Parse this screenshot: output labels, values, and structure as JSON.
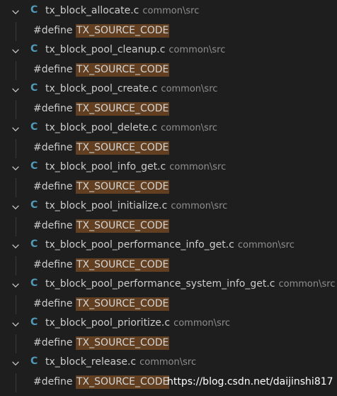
{
  "results": [
    {
      "file": "tx_block_allocate.c",
      "path": "common\\src",
      "match_prefix": "#define ",
      "match_highlight": "TX_SOURCE_CODE"
    },
    {
      "file": "tx_block_pool_cleanup.c",
      "path": "common\\src",
      "match_prefix": "#define ",
      "match_highlight": "TX_SOURCE_CODE"
    },
    {
      "file": "tx_block_pool_create.c",
      "path": "common\\src",
      "match_prefix": "#define ",
      "match_highlight": "TX_SOURCE_CODE"
    },
    {
      "file": "tx_block_pool_delete.c",
      "path": "common\\src",
      "match_prefix": "#define ",
      "match_highlight": "TX_SOURCE_CODE"
    },
    {
      "file": "tx_block_pool_info_get.c",
      "path": "common\\src",
      "match_prefix": "#define ",
      "match_highlight": "TX_SOURCE_CODE"
    },
    {
      "file": "tx_block_pool_initialize.c",
      "path": "common\\src",
      "match_prefix": "#define ",
      "match_highlight": "TX_SOURCE_CODE"
    },
    {
      "file": "tx_block_pool_performance_info_get.c",
      "path": "common\\src",
      "match_prefix": "#define ",
      "match_highlight": "TX_SOURCE_CODE"
    },
    {
      "file": "tx_block_pool_performance_system_info_get.c",
      "path": "common\\src",
      "match_prefix": "#define ",
      "match_highlight": "TX_SOURCE_CODE"
    },
    {
      "file": "tx_block_pool_prioritize.c",
      "path": "common\\src",
      "match_prefix": "#define ",
      "match_highlight": "TX_SOURCE_CODE"
    },
    {
      "file": "tx_block_release.c",
      "path": "common\\src",
      "match_prefix": "#define ",
      "match_highlight": "TX_SOURCE_CODE"
    }
  ],
  "file_icon": {
    "name": "c-language-icon",
    "glyph": "C",
    "color": "#519aba"
  },
  "chevron_icon": "chevron-down-icon",
  "highlight_color": "#613f20",
  "watermark": "https://blog.csdn.net/daijinshi817"
}
